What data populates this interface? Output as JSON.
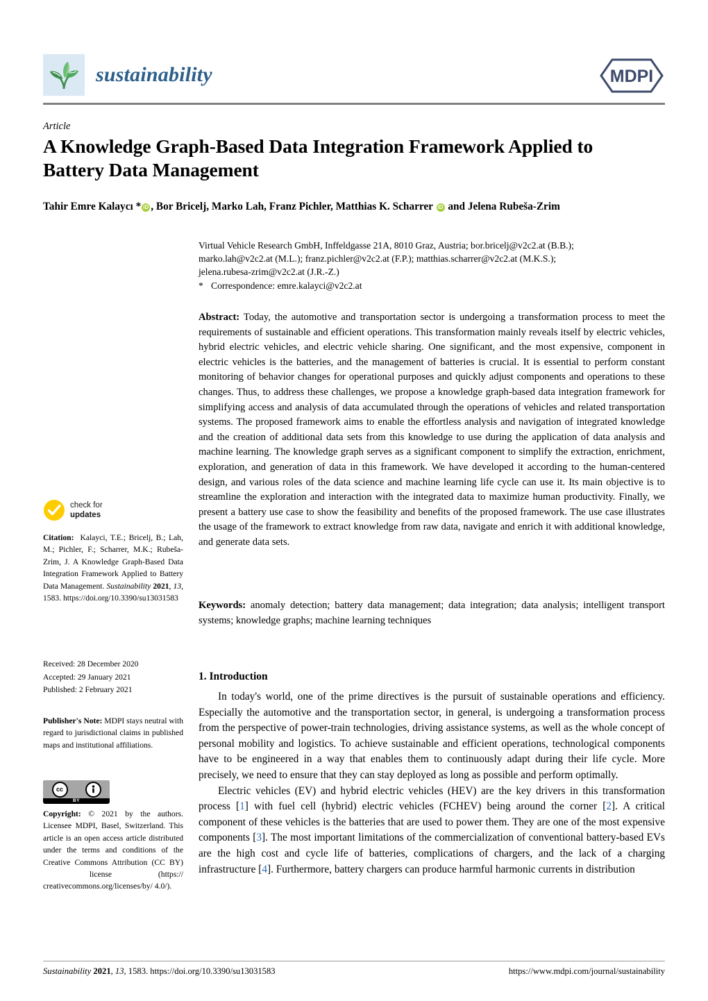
{
  "header": {
    "journal_name": "sustainability",
    "publisher_logo_text": "MDPI"
  },
  "article": {
    "type": "Article",
    "title": "A Knowledge Graph-Based Data Integration Framework Applied to Battery Data Management",
    "authors_html": "Tahir Emre Kalaycı *<span class=\"orcid\" data-name=\"orcid-icon\" data-interactable=\"true\">iD</span>, Bor Bricelj, Marko Lah, Franz Pichler, Matthias K. Scharrer <span class=\"orcid\" data-name=\"orcid-icon\" data-interactable=\"true\">iD</span> and Jelena Rubeša-Zrim",
    "affiliation_line1": "Virtual Vehicle Research GmbH, Inffeldgasse 21A, 8010 Graz, Austria; bor.bricelj@v2c2.at (B.B.);",
    "affiliation_line2": "marko.lah@v2c2.at (M.L.); franz.pichler@v2c2.at (F.P.); matthias.scharrer@v2c2.at (M.K.S.);",
    "affiliation_line3": "jelena.rubesa-zrim@v2c2.at (J.R.-Z.)",
    "correspondence_marker": "*",
    "correspondence": "Correspondence: emre.kalayci@v2c2.at"
  },
  "abstract": {
    "label": "Abstract:",
    "text": "Today, the automotive and transportation sector is undergoing a transformation process to meet the requirements of sustainable and efficient operations. This transformation mainly reveals itself by electric vehicles, hybrid electric vehicles, and electric vehicle sharing. One significant, and the most expensive, component in electric vehicles is the batteries, and the management of batteries is crucial. It is essential to perform constant monitoring of behavior changes for operational purposes and quickly adjust components and operations to these changes. Thus, to address these challenges, we propose a knowledge graph-based data integration framework for simplifying access and analysis of data accumulated through the operations of vehicles and related transportation systems. The proposed framework aims to enable the effortless analysis and navigation of integrated knowledge and the creation of additional data sets from this knowledge to use during the application of data analysis and machine learning. The knowledge graph serves as a significant component to simplify the extraction, enrichment, exploration, and generation of data in this framework. We have developed it according to the human-centered design, and various roles of the data science and machine learning life cycle can use it. Its main objective is to streamline the exploration and interaction with the integrated data to maximize human productivity. Finally, we present a battery use case to show the feasibility and benefits of the proposed framework. The use case illustrates the usage of the framework to extract knowledge from raw data, navigate and enrich it with additional knowledge, and generate data sets."
  },
  "keywords": {
    "label": "Keywords:",
    "text": "anomaly detection; battery data management; data integration; data analysis; intelligent transport systems; knowledge graphs; machine learning techniques"
  },
  "introduction": {
    "heading": "1. Introduction",
    "paragraph1": "In today's world, one of the prime directives is the pursuit of sustainable operations and efficiency. Especially the automotive and the transportation sector, in general, is undergoing a transformation process from the perspective of power-train technologies, driving assistance systems, as well as the whole concept of personal mobility and logistics. To achieve sustainable and efficient operations, technological components have to be engineered in a way that enables them to continuously adapt during their life cycle. More precisely, we need to ensure that they can stay deployed as long as possible and perform optimally.",
    "paragraph2_html": "Electric vehicles (EV) and hybrid electric vehicles (HEV) are the key drivers in this transformation process [<span class=\"ref\">1</span>] with fuel cell (hybrid) electric vehicles (FCHEV) being around the corner [<span class=\"ref\">2</span>]. A critical component of these vehicles is the batteries that are used to power them. They are one of the most expensive components [<span class=\"ref\">3</span>]. The most important limitations of the commercialization of conventional battery-based EVs are the high cost and cycle life of batteries, complications of chargers, and the lack of a charging infrastructure [<span class=\"ref\">4</span>]. Furthermore, battery chargers can produce harmful harmonic currents in distribution"
  },
  "sidebar": {
    "check_updates_line1": "check for",
    "check_updates_line2": "updates",
    "citation_html": "<b>Citation:</b>&nbsp; Kalayci, T.E.; Bricelj, B.; Lah, M.; Pichler, F.; Scharrer, M.K.; Rubeša-Zrim, J. A Knowledge Graph-Based Data Integration Framework Applied to Battery Data Management. <i>Sustainability</i> <b>2021</b>, <i>13</i>, 1583. https://doi.org/10.3390/su13031583",
    "received": "Received: 28 December 2020",
    "accepted": "Accepted: 29 January 2021",
    "published": "Published: 2 February 2021",
    "publisher_note_html": "<b>Publisher's Note:</b> MDPI stays neutral with regard to jurisdictional claims in published maps and institutional affiliations.",
    "cc_mark": "cc",
    "cc_by": "BY",
    "copyright_html": "<b>Copyright:</b> © 2021 by the authors. Licensee MDPI, Basel, Switzerland. This article is an open access article distributed under the terms and conditions of the Creative Commons Attribution (CC BY) &nbsp;license (https:// creativecommons.org/licenses/by/ 4.0/)."
  },
  "footer": {
    "left_html": "<i>Sustainability</i> <b>2021</b>, <i>13</i>, 1583. https://doi.org/10.3390/su13031583",
    "right": "https://www.mdpi.com/journal/sustainability"
  },
  "colors": {
    "journal_blue": "#2d5f8b",
    "logo_bg": "#dbe9f4",
    "leaf_green": "#4a9b5c",
    "mdpi_navy": "#3e4a6b",
    "orcid_green": "#a6ce39",
    "check_yellow": "#ffcc00",
    "reference_link": "#2b6bbf",
    "rule_gray": "#808080"
  }
}
